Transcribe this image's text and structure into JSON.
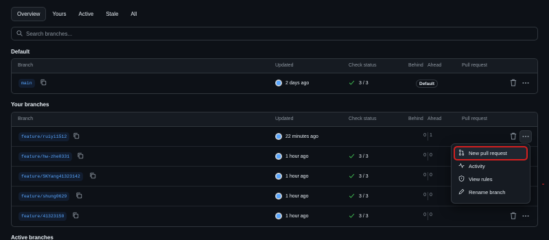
{
  "tabs": [
    "Overview",
    "Yours",
    "Active",
    "Stale",
    "All"
  ],
  "search": {
    "placeholder": "Search branches..."
  },
  "columns": {
    "branch": "Branch",
    "updated": "Updated",
    "check_status": "Check status",
    "behind": "Behind",
    "ahead": "Ahead",
    "pull_request": "Pull request"
  },
  "sections": {
    "default": "Default",
    "yours": "Your branches",
    "active": "Active branches"
  },
  "default_branch": {
    "name": "main",
    "updated": "2 days ago",
    "check": "3 / 3",
    "badge": "Default"
  },
  "your_branches": [
    {
      "name": "feature/ruiyi1512",
      "updated": "22 minutes ago",
      "check": "",
      "behind": "0",
      "ahead": "1"
    },
    {
      "name": "feature/hw-zhe0331",
      "updated": "1 hour ago",
      "check": "3 / 3",
      "behind": "0",
      "ahead": "0"
    },
    {
      "name": "feature/SKYang41323142",
      "updated": "1 hour ago",
      "check": "3 / 3",
      "behind": "0",
      "ahead": "0"
    },
    {
      "name": "feature/shung0629",
      "updated": "1 hour ago",
      "check": "3 / 3",
      "behind": "0",
      "ahead": "0"
    },
    {
      "name": "feature/41323150",
      "updated": "1 hour ago",
      "check": "3 / 3",
      "behind": "0",
      "ahead": "0"
    }
  ],
  "menu": {
    "items": [
      "New pull request",
      "Activity",
      "View rules",
      "Rename branch"
    ]
  },
  "colors": {
    "background": "#0d1117",
    "accent": "#58a6ff",
    "success": "#3fb950",
    "highlight": "#d42020"
  }
}
